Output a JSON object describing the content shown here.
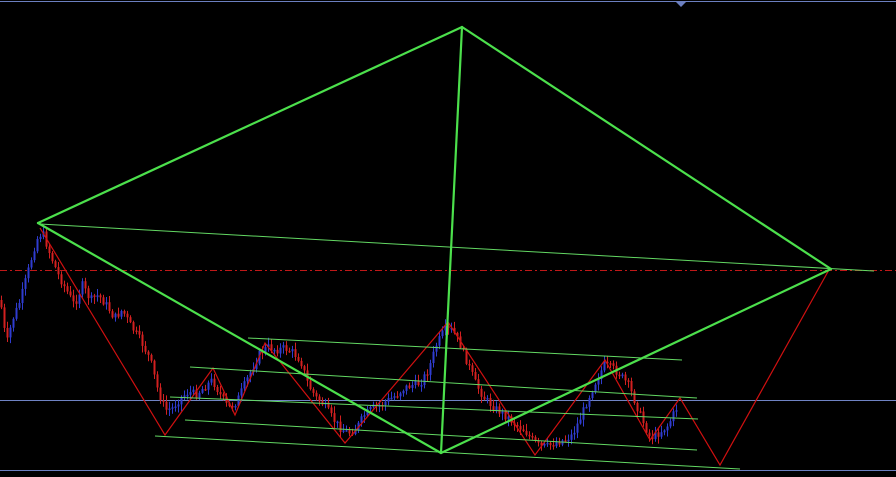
{
  "colors": {
    "background": "#000000",
    "frame": "#6b7fbf",
    "level_line": "#6f83c4",
    "dashed_level": "#c01818",
    "pattern_outline": "#4ce04c",
    "channel_lines": "#63d863",
    "zigzag": "#d01010",
    "bull_candle": "#2f3ccf",
    "bear_candle": "#d22020"
  },
  "icons": {
    "top_marker": "triangle-down-icon"
  }
}
